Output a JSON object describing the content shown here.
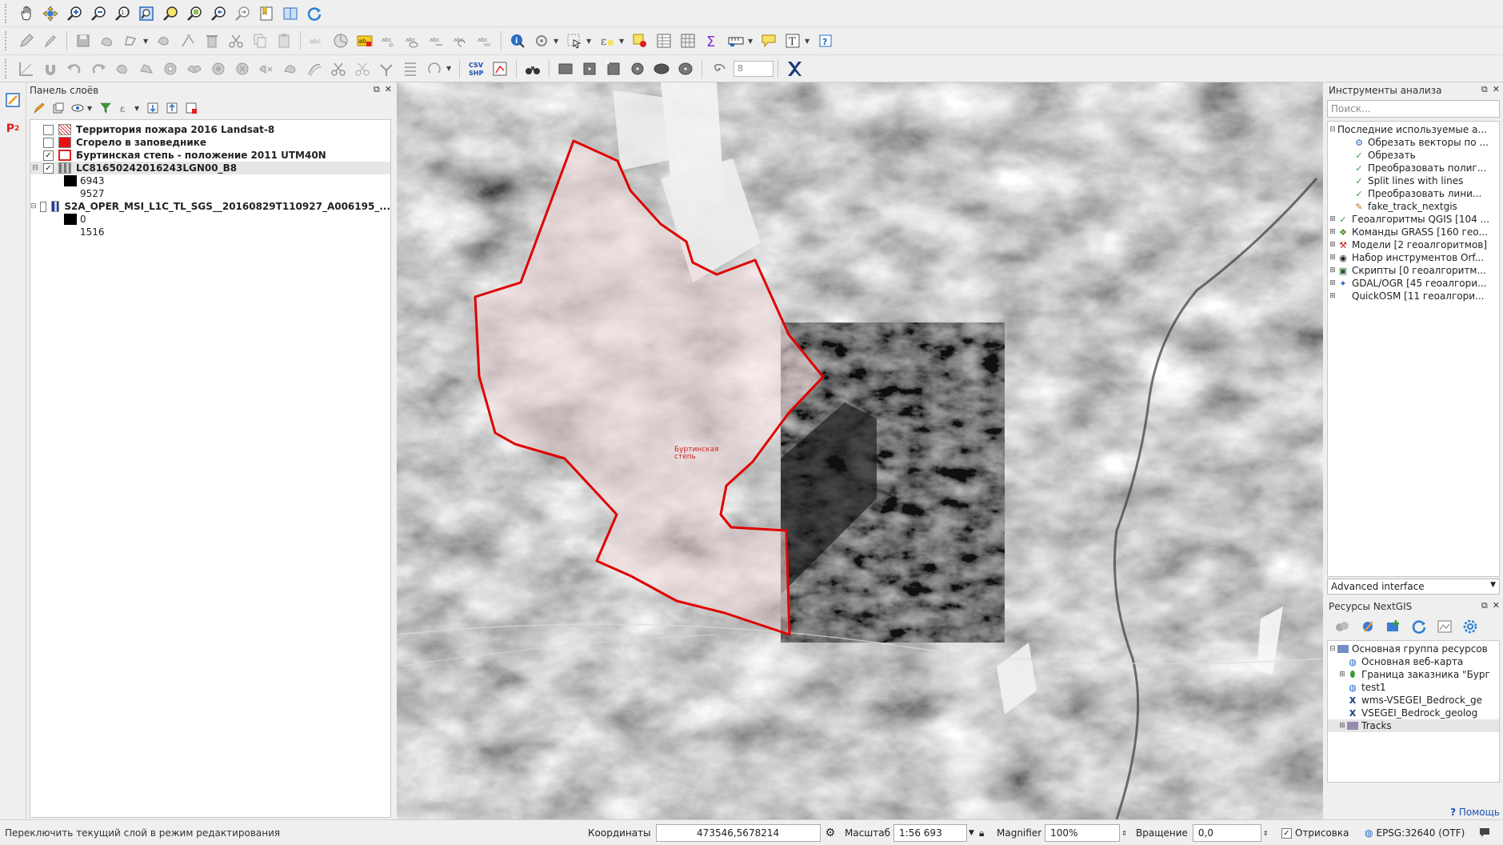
{
  "toolbar1": {
    "icons": [
      "pan-icon",
      "pan-to-selection-icon",
      "zoom-in-icon",
      "zoom-out-icon",
      "zoom-native-icon",
      "zoom-full-icon",
      "zoom-to-selection-icon",
      "zoom-to-layer-icon",
      "zoom-last-icon",
      "zoom-next-icon",
      "new-bookmark-icon",
      "show-bookmarks-icon",
      "refresh-icon"
    ]
  },
  "toolbar2": {
    "spin_value": ""
  },
  "toolbar3": {
    "spin_value": "8",
    "csv_label": "CSV",
    "shp_label": "SHP"
  },
  "left_strip": {
    "p2_label": "P",
    "p2_sup": "2"
  },
  "layers_panel": {
    "title": "Панель слоёв",
    "layers": [
      {
        "name": "Территория пожара 2016 Landsat-8",
        "checked": false,
        "symbol": "hatch-red",
        "selected": false
      },
      {
        "name": "Сгорело в заповеднике",
        "checked": false,
        "symbol": "solid-red",
        "selected": false
      },
      {
        "name": "Буртинская степь - положение 2011 UTM40N",
        "checked": true,
        "symbol": "outline-red",
        "selected": false
      },
      {
        "name": "LC81650242016243LGN00_B8",
        "checked": true,
        "symbol": "raster",
        "selected": true,
        "legend": [
          "6943",
          "9527"
        ]
      },
      {
        "name": "S2A_OPER_MSI_L1C_TL_SGS__20160829T110927_A006195_...",
        "checked": false,
        "symbol": "raster-blue",
        "selected": false,
        "legend": [
          "0",
          "1516"
        ]
      }
    ]
  },
  "map": {
    "feature_label_line1": "Буртинская",
    "feature_label_line2": "степь",
    "polygon_color": "#e00000"
  },
  "processing_panel": {
    "title": "Инструменты анализа",
    "search_placeholder": "Поиск...",
    "recent_group": "Последние используемые а...",
    "recent_items": [
      {
        "label": "Обрезать векторы по ...",
        "icon": "gear-globe-icon"
      },
      {
        "label": "Обрезать",
        "icon": "check-icon"
      },
      {
        "label": "Преобразовать полиг...",
        "icon": "check-icon"
      },
      {
        "label": "Split lines with lines",
        "icon": "check-icon"
      },
      {
        "label": "Преобразовать лини...",
        "icon": "check-icon"
      },
      {
        "label": "fake_track_nextgis",
        "icon": "pencil-icon"
      }
    ],
    "providers": [
      {
        "label": "Геоалгоритмы QGIS [104 ...",
        "icon": "qgis-icon"
      },
      {
        "label": "Команды GRASS [160 гео...",
        "icon": "grass-icon"
      },
      {
        "label": "Модели [2 геоалгоритмов]",
        "icon": "model-icon"
      },
      {
        "label": "Набор инструментов Orf...",
        "icon": "otb-icon"
      },
      {
        "label": "Скрипты [0 геоалгоритм...",
        "icon": "script-icon"
      },
      {
        "label": "GDAL/OGR [45 геоалгори...",
        "icon": "gdal-icon"
      },
      {
        "label": "QuickOSM [11 геоалгори...",
        "icon": "quickosm-icon"
      }
    ],
    "interface_mode": "Advanced interface"
  },
  "nextgis_panel": {
    "title": "Ресурсы NextGIS",
    "root": "Основная группа ресурсов",
    "items": [
      {
        "label": "Основная веб-карта",
        "icon": "webmap-icon",
        "expandable": false
      },
      {
        "label": "Граница заказника \"Бург",
        "icon": "vector-layer-icon",
        "expandable": true
      },
      {
        "label": "test1",
        "icon": "webmap-icon",
        "expandable": false
      },
      {
        "label": "wms-VSEGEI_Bedrock_ge",
        "icon": "wms-icon",
        "expandable": false
      },
      {
        "label": "VSEGEI_Bedrock_geolog",
        "icon": "wms-icon",
        "expandable": false
      },
      {
        "label": "Tracks",
        "icon": "folder-icon",
        "expandable": true
      }
    ],
    "help_label": "Помощь"
  },
  "statusbar": {
    "message": "Переключить текущий слой в режим редактирования",
    "coords_label": "Координаты",
    "coords_value": "473546,5678214",
    "scale_label": "Масштаб",
    "scale_value": "1:56 693",
    "magnifier_label": "Magnifier",
    "magnifier_value": "100%",
    "rotation_label": "Вращение",
    "rotation_value": "0,0",
    "render_label": "Отрисовка",
    "crs_label": "EPSG:32640 (OTF)"
  }
}
